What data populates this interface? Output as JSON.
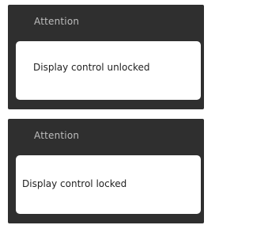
{
  "dialogs": [
    {
      "title": "Attention",
      "message": "Display control unlocked"
    },
    {
      "title": "Attention",
      "message": "Display control locked"
    }
  ],
  "colors": {
    "panel_background": "#2f2f2f",
    "title_text": "#bdbdbd",
    "message_background": "#ffffff",
    "message_text": "#222222"
  }
}
